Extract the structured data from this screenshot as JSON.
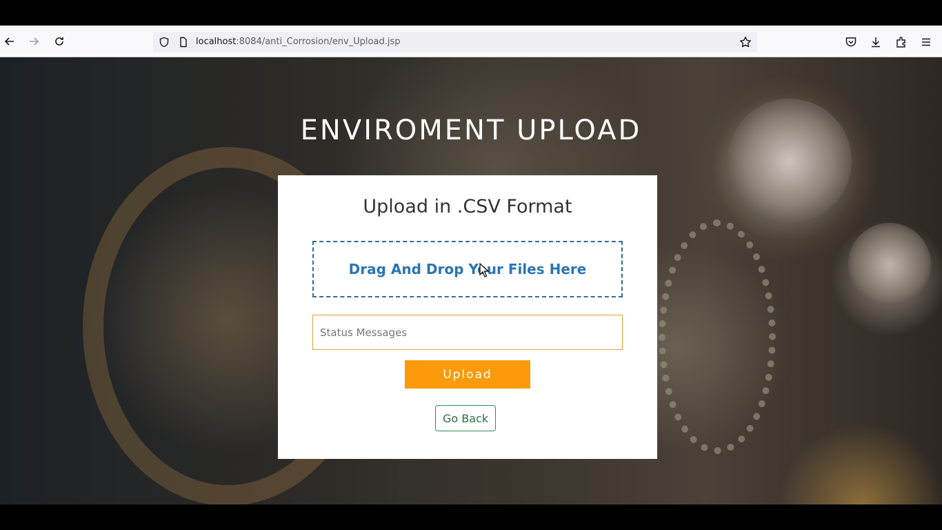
{
  "browser": {
    "url_host": "localhost",
    "url_rest": ":8084/anti_Corrosion/env_Upload.jsp",
    "icons": {
      "back": "arrow-left-icon",
      "forward": "arrow-right-icon",
      "reload": "reload-icon",
      "shield": "shield-icon",
      "page": "page-icon",
      "bookmark": "star-icon",
      "pocket": "pocket-icon",
      "downloads": "download-icon",
      "extensions": "puzzle-icon",
      "menu": "hamburger-menu-icon"
    }
  },
  "page": {
    "heading": "ENVIROMENT UPLOAD",
    "card": {
      "title": "Upload in .CSV Format",
      "dropzone_label": "Drag And Drop Your Files Here",
      "status_placeholder": "Status Messages",
      "upload_label": "Upload",
      "back_label": "Go Back"
    }
  },
  "colors": {
    "upload_button": "#fb9a0a",
    "dropzone_text": "#2a75b3",
    "status_border": "#e0a030",
    "back_border": "#2f8f5a"
  }
}
